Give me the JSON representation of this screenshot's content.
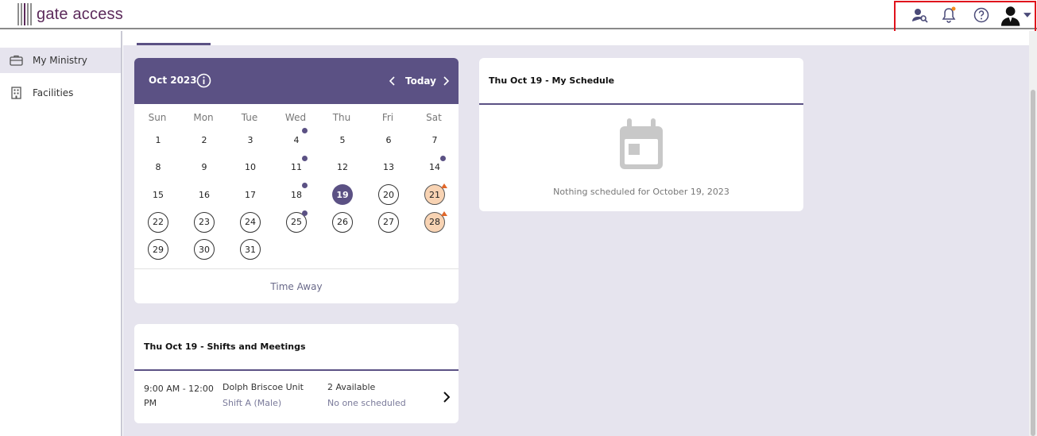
{
  "header": {
    "logo_text": "gate access",
    "icons": [
      "person-search-icon",
      "bell-icon",
      "help-icon",
      "user-avatar"
    ]
  },
  "sidebar": {
    "items": [
      {
        "label": "My Ministry",
        "icon": "briefcase-icon",
        "active": true
      },
      {
        "label": "Facilities",
        "icon": "building-icon",
        "active": false
      }
    ]
  },
  "calendar": {
    "month_label": "Oct 2023",
    "today_label": "Today",
    "weekdays": [
      "Sun",
      "Mon",
      "Tue",
      "Wed",
      "Thu",
      "Fri",
      "Sat"
    ],
    "days": [
      {
        "d": "1",
        "style": "plain"
      },
      {
        "d": "2",
        "style": "plain"
      },
      {
        "d": "3",
        "style": "plain"
      },
      {
        "d": "4",
        "style": "plain",
        "dot": true
      },
      {
        "d": "5",
        "style": "plain"
      },
      {
        "d": "6",
        "style": "plain"
      },
      {
        "d": "7",
        "style": "plain"
      },
      {
        "d": "8",
        "style": "plain"
      },
      {
        "d": "9",
        "style": "plain"
      },
      {
        "d": "10",
        "style": "plain"
      },
      {
        "d": "11",
        "style": "plain",
        "dot": true
      },
      {
        "d": "12",
        "style": "plain"
      },
      {
        "d": "13",
        "style": "plain"
      },
      {
        "d": "14",
        "style": "plain",
        "dot": true
      },
      {
        "d": "15",
        "style": "plain"
      },
      {
        "d": "16",
        "style": "plain"
      },
      {
        "d": "17",
        "style": "plain"
      },
      {
        "d": "18",
        "style": "plain",
        "dot": true
      },
      {
        "d": "19",
        "style": "selected"
      },
      {
        "d": "20",
        "style": "ring"
      },
      {
        "d": "21",
        "style": "peach",
        "flag": true
      },
      {
        "d": "22",
        "style": "ring"
      },
      {
        "d": "23",
        "style": "ring"
      },
      {
        "d": "24",
        "style": "ring"
      },
      {
        "d": "25",
        "style": "ring",
        "dot": true
      },
      {
        "d": "26",
        "style": "ring"
      },
      {
        "d": "27",
        "style": "ring"
      },
      {
        "d": "28",
        "style": "peach",
        "flag": true
      },
      {
        "d": "29",
        "style": "ring"
      },
      {
        "d": "30",
        "style": "ring"
      },
      {
        "d": "31",
        "style": "ring"
      }
    ],
    "footer_label": "Time Away",
    "colors": {
      "primary": "#5b5184",
      "peach": "#f8d3b3",
      "flag": "#e0672a"
    }
  },
  "my_schedule": {
    "title": "Thu Oct 19 - My Schedule",
    "empty_text": "Nothing scheduled for October 19, 2023"
  },
  "shifts": {
    "title": "Thu Oct 19 - Shifts and Meetings",
    "rows": [
      {
        "time": "9:00 AM - 12:00 PM",
        "unit": "Dolph Briscoe Unit",
        "shift": "Shift A (Male)",
        "available": "2 Available",
        "scheduled": "No one scheduled"
      }
    ]
  }
}
